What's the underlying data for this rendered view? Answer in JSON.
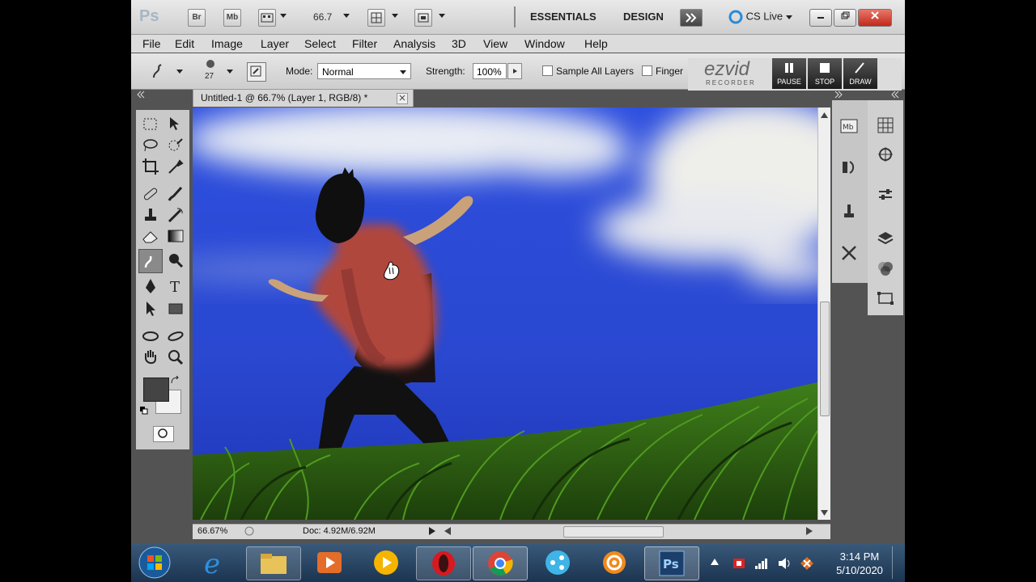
{
  "app": {
    "logo": "Ps",
    "bridge_label": "Br",
    "minibridge_label": "Mb",
    "zoom_value": "66.7",
    "workspace_essentials": "ESSENTIALS",
    "workspace_design": "DESIGN",
    "cs_live": "CS Live"
  },
  "menubar": {
    "items": [
      "File",
      "Edit",
      "Image",
      "Layer",
      "Select",
      "Filter",
      "Analysis",
      "3D",
      "View",
      "Window",
      "Help"
    ]
  },
  "options": {
    "brush_size": "27",
    "mode_label": "Mode:",
    "mode_value": "Normal",
    "strength_label": "Strength:",
    "strength_value": "100%",
    "sample_all_layers": "Sample All Layers",
    "finger_label": "Finger"
  },
  "ezvid": {
    "logo": "ezvid",
    "subtitle": "RECORDER",
    "pause": "PAUSE",
    "stop": "STOP",
    "draw": "DRAW"
  },
  "document": {
    "tab_title": "Untitled-1 @ 66.7% (Layer 1, RGB/8) *",
    "zoom_status": "66.67%",
    "doc_size": "Doc: 4.92M/6.92M"
  },
  "taskbar": {
    "time": "3:14 PM",
    "date": "5/10/2020"
  },
  "colors": {
    "foreground": "#444444",
    "background": "#f2f2f2",
    "sky": "#2a4ad6",
    "shirt": "#b34a42",
    "skin": "#c9a27a",
    "grass": "#2f6a12"
  }
}
